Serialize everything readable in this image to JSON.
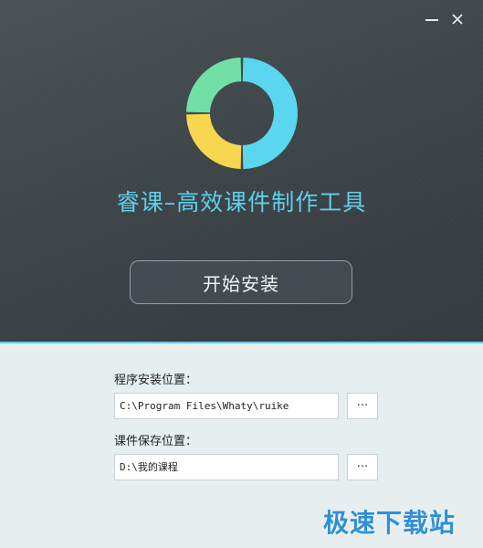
{
  "window": {
    "minimize_icon": "minimize-icon",
    "close_icon": "close-icon"
  },
  "logo": {
    "segments": [
      {
        "color": "#5ad6ef",
        "fraction": 0.5
      },
      {
        "color": "#f8d650",
        "fraction": 0.25
      },
      {
        "color": "#72e0a6",
        "fraction": 0.25
      }
    ]
  },
  "header": {
    "title": "睿课–高效课件制作工具",
    "title_color": "#5ed0ec"
  },
  "install_button": {
    "label": "开始安装"
  },
  "install_location": {
    "label": "程序安装位置：",
    "value": "C:\\Program Files\\Whaty\\ruike",
    "browse_label": "···"
  },
  "save_location": {
    "label": "课件保存位置：",
    "value": "D:\\我的课程",
    "browse_label": "···"
  },
  "watermark": {
    "text": "极速下载站",
    "color": "#2f8fd6"
  },
  "colors": {
    "accent": "#5ec9e6",
    "panel_dark": "#3c4347",
    "panel_light": "#e7eef0"
  }
}
